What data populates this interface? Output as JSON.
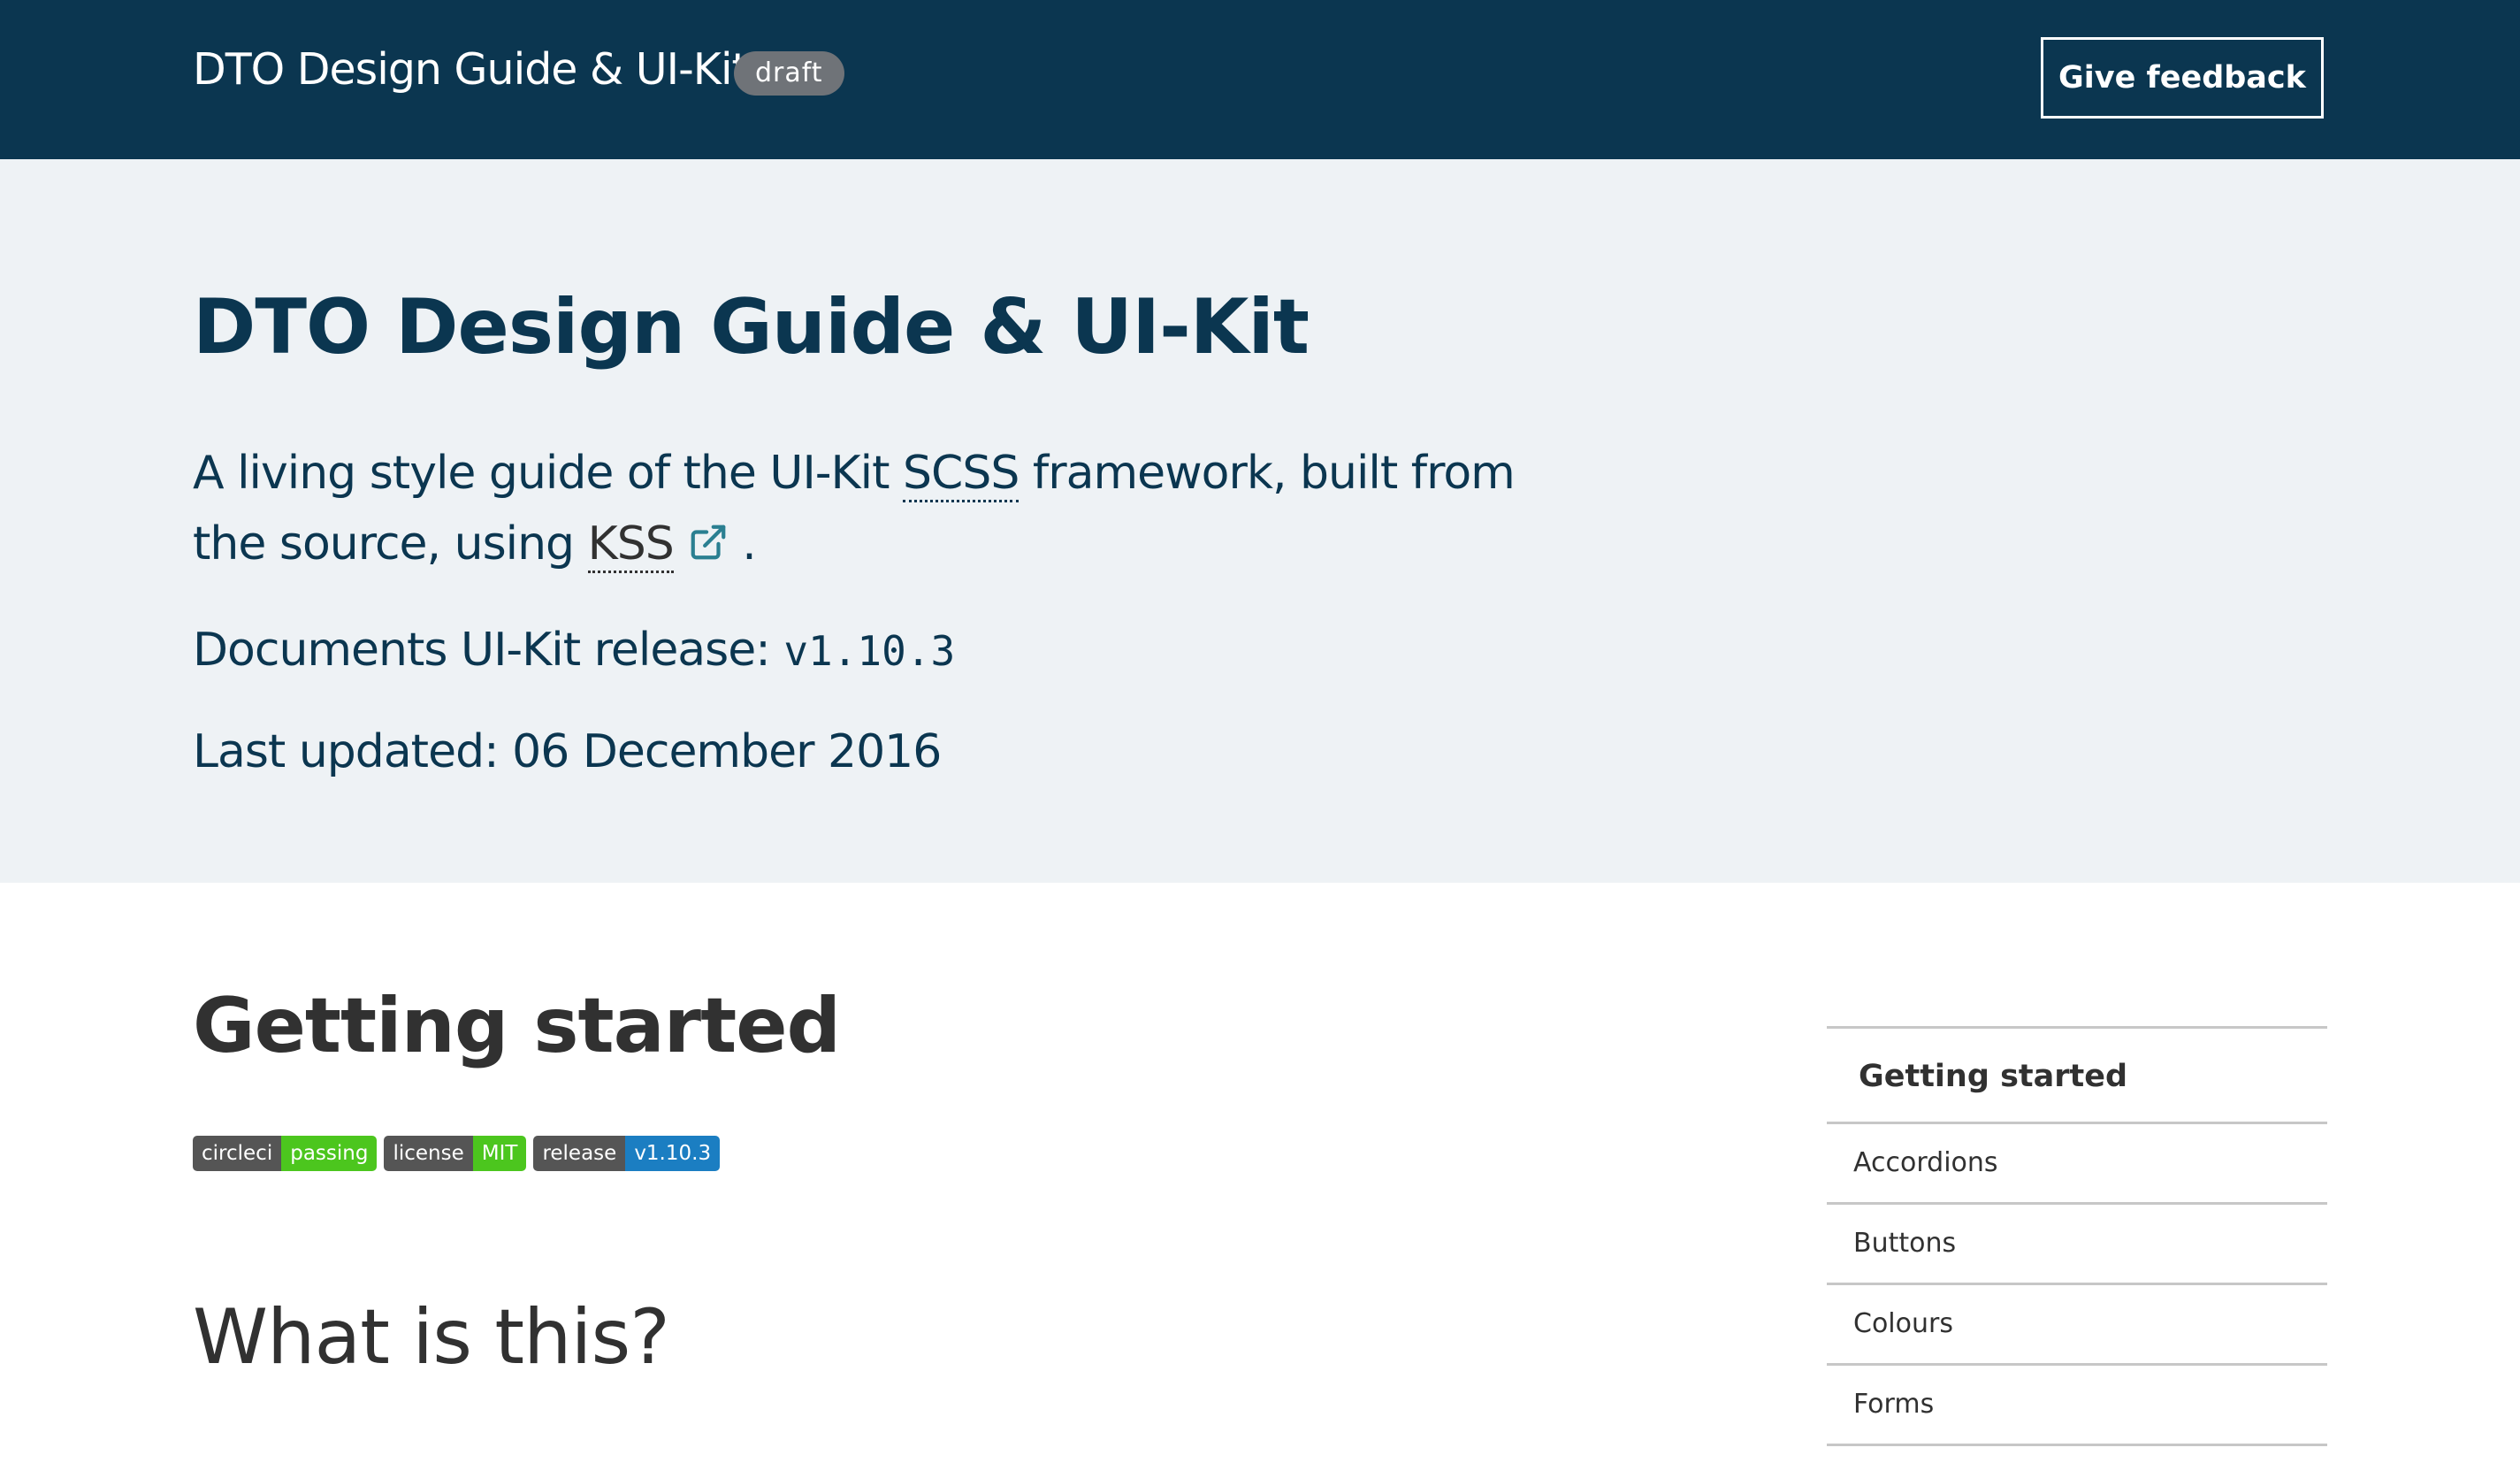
{
  "header": {
    "site_title": "DTO Design Guide & UI-Kit",
    "status_badge": "draft",
    "feedback_label": "Give feedback"
  },
  "hero": {
    "title": "DTO Design Guide & UI-Kit",
    "desc_part1": "A living style guide of the UI-Kit ",
    "abbr_scss": "SCSS",
    "desc_part2": " framework, built from the source, using ",
    "link_kss": "KSS",
    "desc_part3": " .",
    "release_label": "Documents UI-Kit release: ",
    "release_version": "v1.10.3",
    "updated": "Last updated: 06 December 2016"
  },
  "main": {
    "section_title": "Getting started",
    "badges": [
      {
        "label": "circleci",
        "value": "passing",
        "color": "#4cc61e"
      },
      {
        "label": "license",
        "value": "MIT",
        "color": "#4cc61e"
      },
      {
        "label": "release",
        "value": "v1.10.3",
        "color": "#1b7ec2"
      }
    ],
    "subsection_title": "What is this?"
  },
  "sidebar": {
    "heading": "Getting started",
    "items": [
      {
        "label": "Accordions"
      },
      {
        "label": "Buttons"
      },
      {
        "label": "Colours"
      },
      {
        "label": "Forms"
      }
    ]
  },
  "colors": {
    "header_bg": "#0b3650",
    "hero_bg": "#eef2f5",
    "link_icon": "#2a7f91",
    "divider": "#c7c7c7"
  },
  "icons": {
    "external_link": "external-link-icon"
  }
}
